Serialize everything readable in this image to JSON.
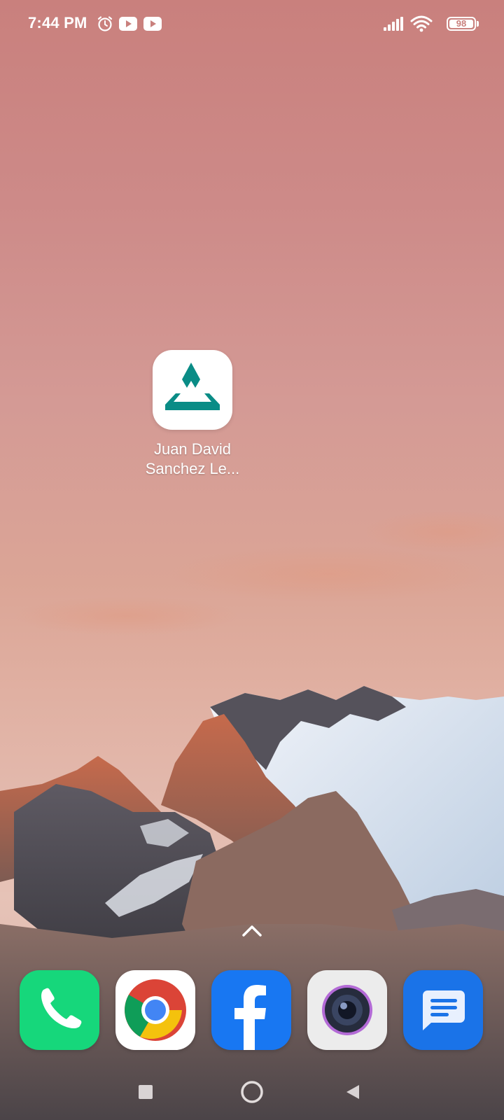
{
  "status_bar": {
    "time": "7:44 PM",
    "battery_level": "98",
    "icons": [
      "alarm-icon",
      "youtube-icon",
      "youtube-icon",
      "signal-icon",
      "wifi-icon",
      "battery-icon"
    ]
  },
  "home": {
    "apps": [
      {
        "label_line1": "Juan David",
        "label_line2": "Sanchez Le...",
        "icon": "juan-david-app-icon",
        "color": "#0a8c86"
      }
    ]
  },
  "dock": {
    "apps": [
      {
        "icon": "phone-icon",
        "color": "#16d77b"
      },
      {
        "icon": "chrome-icon",
        "color": "#ffffff"
      },
      {
        "icon": "facebook-icon",
        "color": "#1877f2"
      },
      {
        "icon": "camera-icon",
        "color": "#ececec"
      },
      {
        "icon": "messages-icon",
        "color": "#1a73e8"
      }
    ]
  },
  "navigation": {
    "buttons": [
      "recents-button",
      "home-button",
      "back-button"
    ]
  },
  "colors": {
    "sky_top": "#c9807d",
    "sky_bottom": "#e6c3b7",
    "text": "#ffffff"
  }
}
